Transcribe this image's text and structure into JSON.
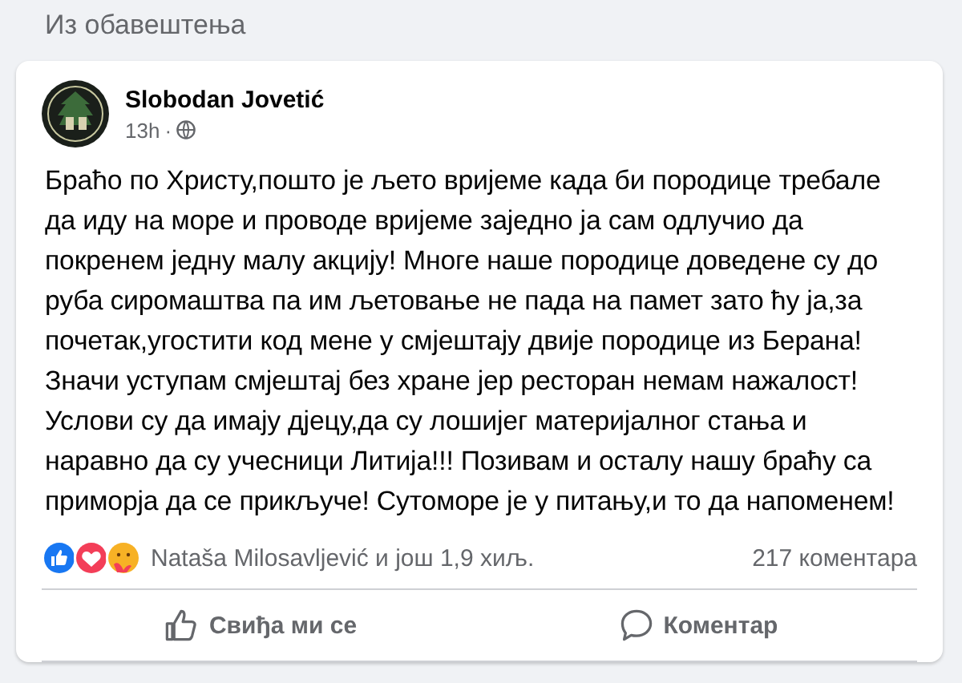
{
  "section_title": "Из обавештења",
  "post": {
    "author": "Slobodan Jovetić",
    "time": "13h",
    "separator": "·",
    "body": "Браћо по Христу,пошто је љето вријеме када би породице требале да иду на море и проводе вријеме заједно ја сам одлучио да покренем једну малу акцију! Многе наше породице доведене су до руба сиромаштва па им љетовање не пада на памет зато ћу ја,за почетак,угостити код мене у смјештају двије породице из Берана! Значи уступам смјештај без хране јер ресторан немам нажалост!Услови су да имају дјецу,да су лошијег материјалног стања и наравно да су учесници Литија!!! Позивам и осталу нашу браћу са приморја да се прикључе! Сутоморе је у питању,и то да напоменем!",
    "reactions": {
      "icons": [
        {
          "kind": "like"
        },
        {
          "kind": "love"
        },
        {
          "kind": "care"
        }
      ],
      "text": "Nataša Milosavljević и још 1,9 хиљ.",
      "comments": "217 коментара"
    },
    "actions": [
      {
        "kind": "like",
        "label": "Свиђа ми се"
      },
      {
        "kind": "comment",
        "label": "Коментар"
      }
    ]
  }
}
